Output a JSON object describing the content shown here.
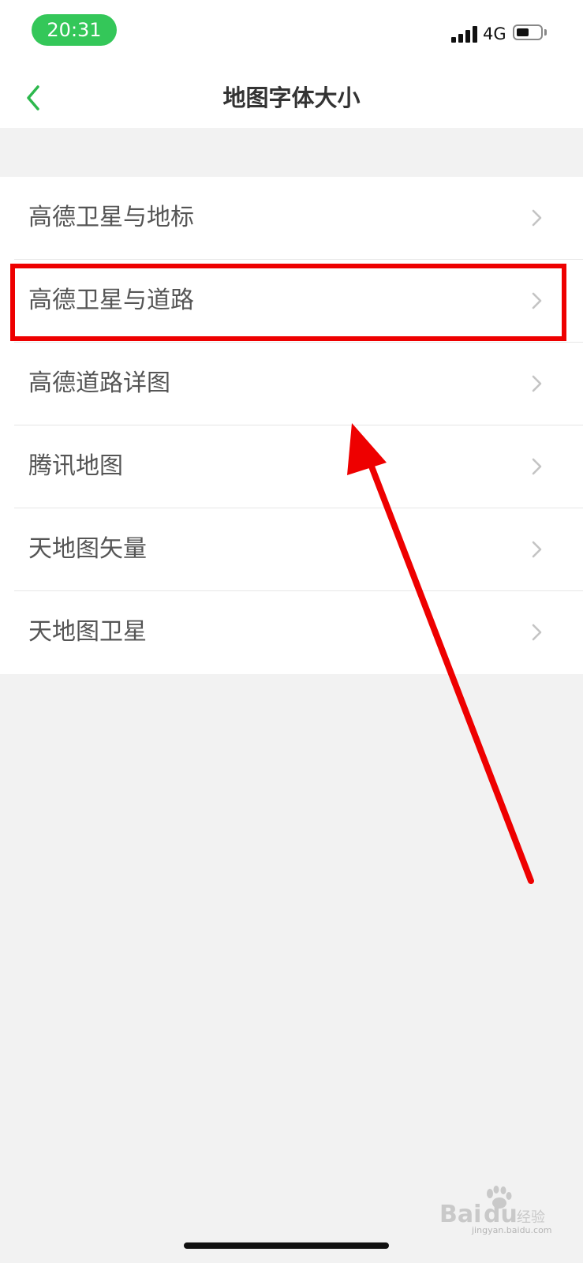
{
  "status_bar": {
    "time": "20:31",
    "network": "4G",
    "signal_bars": 4,
    "battery_level": 0.55,
    "time_pill_color": "#34c759"
  },
  "nav": {
    "title": "地图字体大小",
    "back_icon": "chevron-left-icon",
    "accent_color": "#2db84d"
  },
  "list": {
    "items": [
      {
        "label": "高德卫星与地标",
        "icon": "chevron-right-icon"
      },
      {
        "label": "高德卫星与道路",
        "icon": "chevron-right-icon"
      },
      {
        "label": "高德道路详图",
        "icon": "chevron-right-icon"
      },
      {
        "label": "腾讯地图",
        "icon": "chevron-right-icon"
      },
      {
        "label": "天地图矢量",
        "icon": "chevron-right-icon"
      },
      {
        "label": "天地图卫星",
        "icon": "chevron-right-icon"
      }
    ]
  },
  "annotation": {
    "color": "#ee0000",
    "highlighted_item": "高德卫星与道路"
  },
  "watermark": {
    "brand": "Baidu经验",
    "sub": "jingyan.baidu.com"
  }
}
